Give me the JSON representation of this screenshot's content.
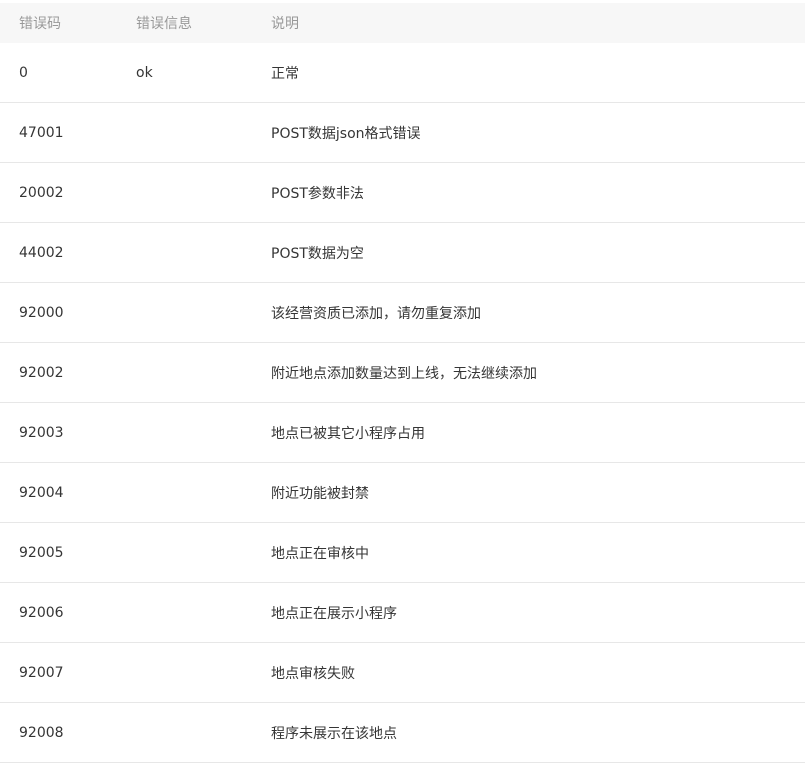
{
  "table": {
    "headers": {
      "code": "错误码",
      "message": "错误信息",
      "description": "说明"
    },
    "rows": [
      {
        "code": "0",
        "message": "ok",
        "description": "正常"
      },
      {
        "code": "47001",
        "message": "",
        "description": "POST数据json格式错误"
      },
      {
        "code": "20002",
        "message": "",
        "description": "POST参数非法"
      },
      {
        "code": "44002",
        "message": "",
        "description": "POST数据为空"
      },
      {
        "code": "92000",
        "message": "",
        "description": "该经营资质已添加，请勿重复添加"
      },
      {
        "code": "92002",
        "message": "",
        "description": "附近地点添加数量达到上线，无法继续添加"
      },
      {
        "code": "92003",
        "message": "",
        "description": "地点已被其它小程序占用"
      },
      {
        "code": "92004",
        "message": "",
        "description": "附近功能被封禁"
      },
      {
        "code": "92005",
        "message": "",
        "description": "地点正在审核中"
      },
      {
        "code": "92006",
        "message": "",
        "description": "地点正在展示小程序"
      },
      {
        "code": "92007",
        "message": "",
        "description": "地点审核失败"
      },
      {
        "code": "92008",
        "message": "",
        "description": "程序未展示在该地点"
      }
    ]
  }
}
